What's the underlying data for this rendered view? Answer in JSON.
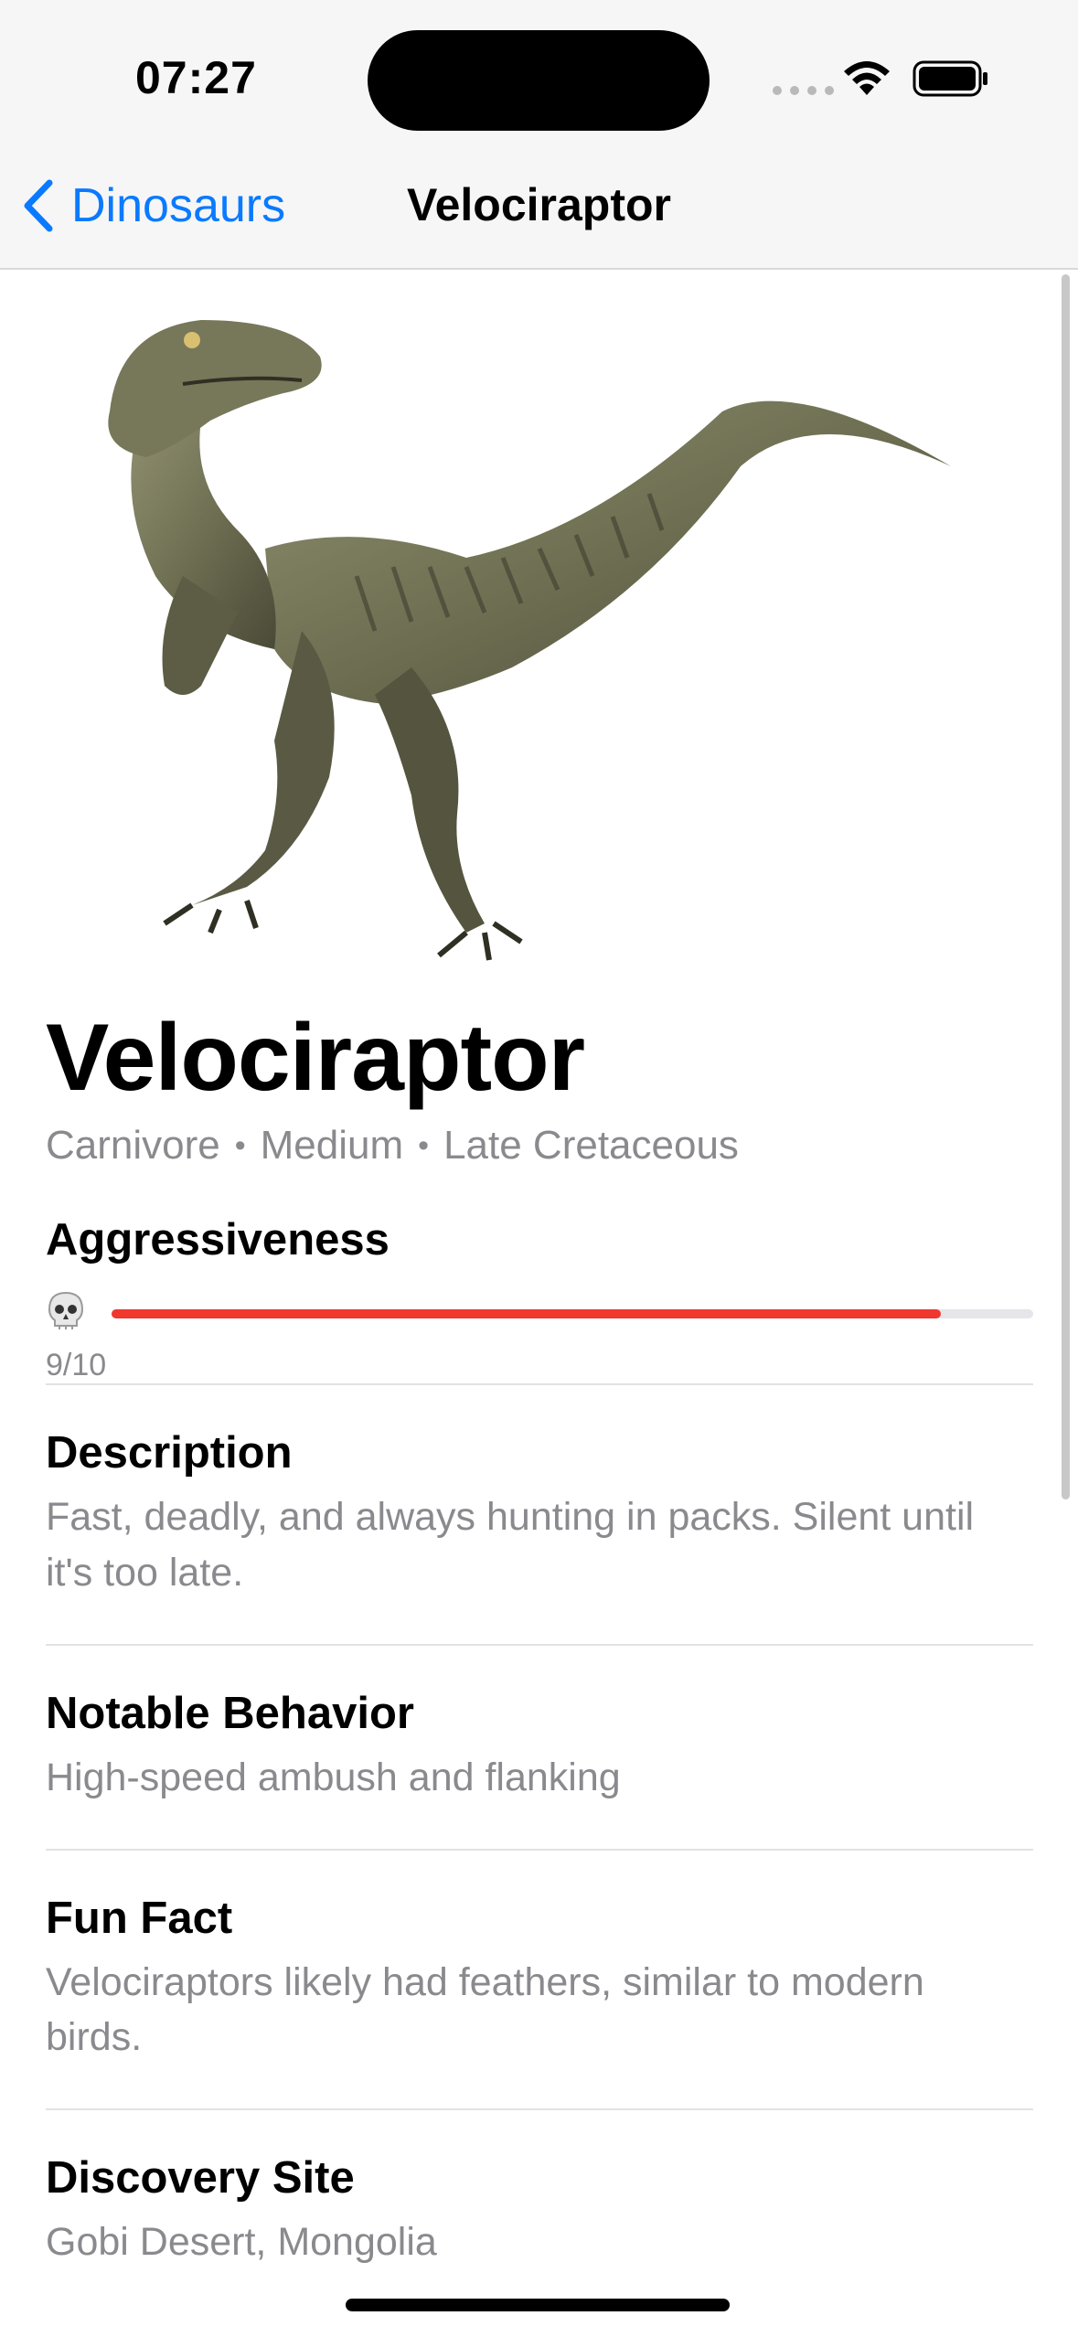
{
  "status_bar": {
    "time": "07:27"
  },
  "nav": {
    "back_label": "Dinosaurs",
    "title": "Velociraptor"
  },
  "dinosaur": {
    "name": "Velociraptor",
    "diet": "Carnivore",
    "size": "Medium",
    "period": "Late Cretaceous",
    "separator": "•"
  },
  "aggressiveness": {
    "label": "Aggressiveness",
    "value": 9,
    "max": 10,
    "score_text": "9/10",
    "icon": "skull-icon",
    "bar_color": "#f0382f"
  },
  "sections": {
    "description": {
      "title": "Description",
      "body": "Fast, deadly, and always hunting in packs. Silent until it's too late."
    },
    "behavior": {
      "title": "Notable Behavior",
      "body": "High-speed ambush and flanking"
    },
    "fun_fact": {
      "title": "Fun Fact",
      "body": "Velociraptors likely had feathers, similar to modern birds."
    },
    "discovery": {
      "title": "Discovery Site",
      "body": "Gobi Desert, Mongolia"
    }
  },
  "colors": {
    "accent": "#0a7aff",
    "secondary_text": "#8a8a8e"
  }
}
